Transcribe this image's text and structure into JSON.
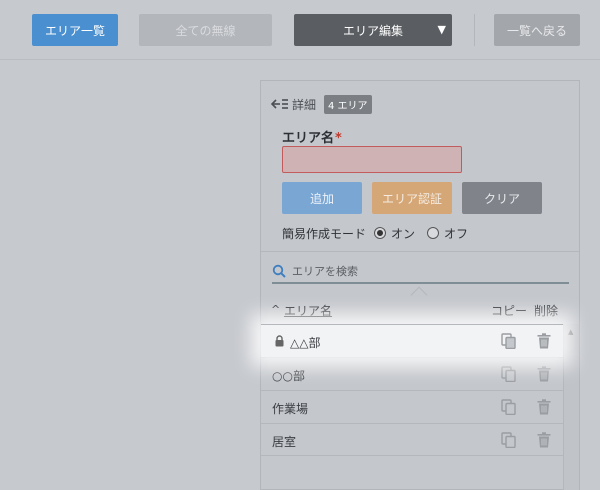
{
  "toolbar": {
    "area_list": "エリア一覧",
    "all_wireless": "全ての無線",
    "area_edit": "エリア編集",
    "area_edit_caret": "▼",
    "back_to_list": "一覧へ戻る"
  },
  "panel": {
    "detail_label": "詳細",
    "area_count_badge": "4 エリア",
    "name_label": "エリア名",
    "required_mark": "*",
    "name_value": "",
    "buttons": {
      "add": "追加",
      "auth": "エリア認証",
      "clear": "クリア"
    },
    "mode": {
      "label": "簡易作成モード",
      "on": "オン",
      "off": "オフ",
      "selected": "on"
    },
    "search_placeholder": "エリアを検索",
    "list_header": {
      "sort_arrow": "^",
      "name": "エリア名",
      "copy": "コピー",
      "delete": "削除"
    },
    "areas": [
      {
        "name": "△△部",
        "locked": true
      },
      {
        "name": "○○部",
        "locked": false
      },
      {
        "name": "作業場",
        "locked": false
      },
      {
        "name": "居室",
        "locked": false
      }
    ]
  },
  "icons": [
    "back-arrow-icon",
    "search-icon",
    "lock-icon",
    "copy-icon",
    "trash-icon"
  ],
  "colors": {
    "primary": "#4a8fd0",
    "dark": "#5a5d62",
    "auth": "#d5a777",
    "error": "#c25c5c"
  }
}
